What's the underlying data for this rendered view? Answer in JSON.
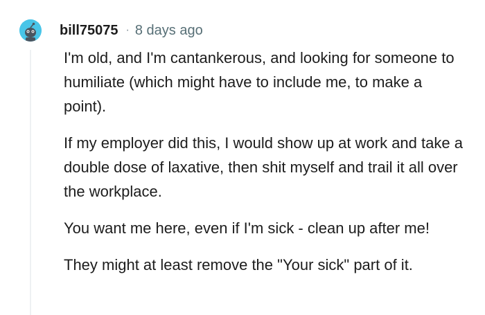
{
  "comment": {
    "author": "bill75075",
    "separator": "·",
    "timestamp": "8 days ago",
    "avatar_icon": "snoo-avatar-icon",
    "avatar_color": "#49c5e8",
    "paragraphs": [
      "I'm old, and I'm cantankerous, and looking for someone to humiliate (which might have to include me, to make a point).",
      "If my employer did this, I would show up at work and take a double dose of laxative, then shit myself and trail it all over the workplace.",
      "You want me here, even if I'm sick - clean up after me!",
      "They might at least remove the \"Your sick\" part of it."
    ]
  }
}
